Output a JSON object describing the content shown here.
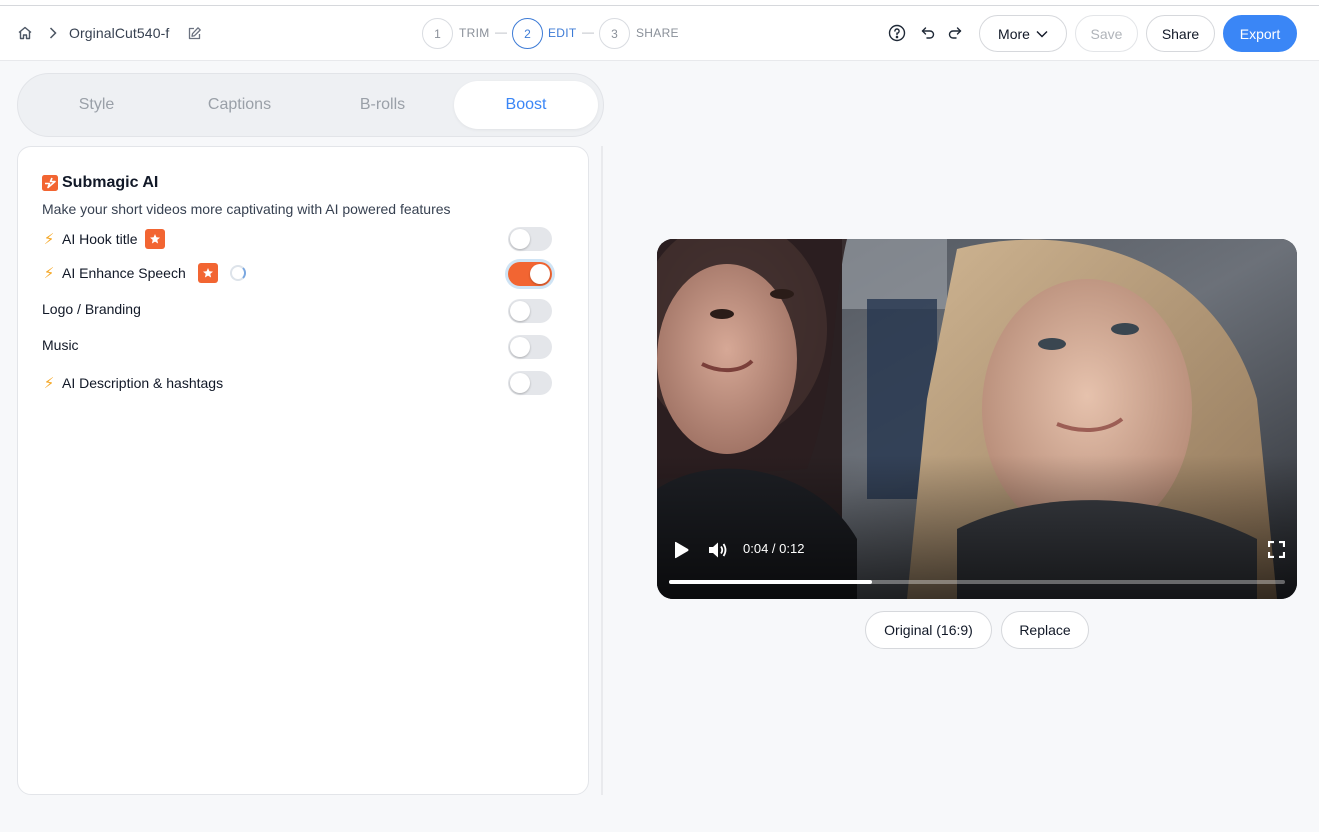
{
  "header": {
    "project_title": "OrginalCut540-f",
    "steps": [
      {
        "number": "1",
        "label": "TRIM"
      },
      {
        "number": "2",
        "label": "EDIT"
      },
      {
        "number": "3",
        "label": "SHARE"
      }
    ],
    "active_step": "EDIT",
    "step_separator": "—",
    "more_label": "More",
    "save_label": "Save",
    "share_label": "Share",
    "export_label": "Export",
    "icons": [
      "home-icon",
      "chevron-right-icon",
      "edit-pencil-icon",
      "help-circle-icon",
      "undo-icon",
      "redo-icon",
      "chevron-down-icon"
    ]
  },
  "tabs": [
    {
      "label": "Style",
      "active": false
    },
    {
      "label": "Captions",
      "active": false
    },
    {
      "label": "B-rolls",
      "active": false
    },
    {
      "label": "Boost",
      "active": true
    }
  ],
  "boost": {
    "title": "Submagic AI",
    "description": "Make your short videos more captivating with AI powered features",
    "features": [
      {
        "label": "AI Hook title",
        "ai": true,
        "premium": true,
        "loading": false,
        "enabled": false
      },
      {
        "label": "AI Enhance Speech",
        "ai": true,
        "premium": true,
        "loading": true,
        "enabled": true
      },
      {
        "label": "Logo / Branding",
        "ai": false,
        "premium": false,
        "loading": false,
        "enabled": false
      },
      {
        "label": "Music",
        "ai": false,
        "premium": false,
        "loading": false,
        "enabled": false
      },
      {
        "label": "AI Description & hashtags",
        "ai": true,
        "premium": false,
        "loading": false,
        "enabled": false
      }
    ]
  },
  "video": {
    "time_display": "0:04 / 0:12",
    "progress": 0.33,
    "icons": [
      "play-icon",
      "volume-icon",
      "fullscreen-icon"
    ]
  },
  "video_actions": {
    "aspect_label": "Original (16:9)",
    "replace_label": "Replace"
  },
  "colors": {
    "accent": "#3a86f6",
    "brand_orange": "#f26532",
    "ai_bolt": "#f5a623"
  }
}
